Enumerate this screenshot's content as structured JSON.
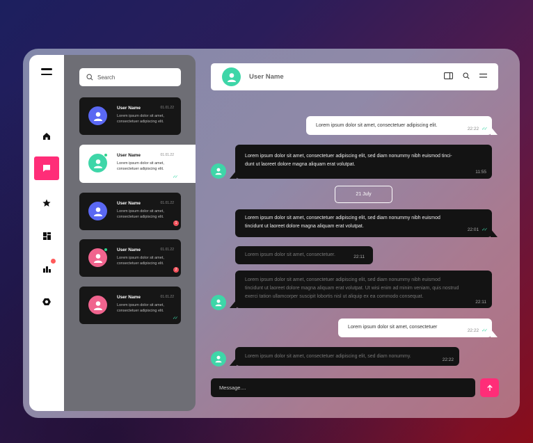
{
  "search": {
    "placeholder": "Search"
  },
  "nav": {
    "items": [
      {
        "icon": "home-icon"
      },
      {
        "icon": "chat-icon",
        "active": true
      },
      {
        "icon": "star-icon"
      },
      {
        "icon": "dashboard-icon"
      },
      {
        "icon": "chart-icon",
        "badge": true
      },
      {
        "icon": "settings-icon"
      }
    ],
    "accent": "#ff2d78"
  },
  "conversations": [
    {
      "name": "User Name",
      "time": "01.01.22",
      "preview": "Lorem ipsum dolor sit amet, consectetuer adipiscing elit.",
      "avatar_color": "#5a68f3"
    },
    {
      "name": "User Name",
      "time": "01.01.22",
      "preview": "Lorem ipsum dolor sit amet, consectetuer adipiscing elit.",
      "avatar_color": "#3ed6a8",
      "active": true
    },
    {
      "name": "User Name",
      "time": "01.01.22",
      "preview": "Lorem ipsum dolor sit amet, consectetuer adipiscing elit.",
      "avatar_color": "#5a68f3",
      "unread": "1"
    },
    {
      "name": "User Name",
      "time": "01.01.22",
      "preview": "Lorem ipsum dolor sit amet, consectetuer adipiscing elit.",
      "avatar_color": "#f0648e",
      "unread": "2"
    },
    {
      "name": "User Name",
      "time": "01.01.22",
      "preview": "Lorem ipsum dolor sit amet, consectetuer adipiscing elit.",
      "avatar_color": "#f0648e"
    }
  ],
  "chat": {
    "header_name": "User Name",
    "date_divider": "21 July",
    "messages": [
      {
        "dir": "out",
        "text": "Lorem ipsum dolor sit amet, consectetuer adipiscing elit.",
        "time": "22:22"
      },
      {
        "dir": "in",
        "line1": "Lorem ipsum dolor sit amet, consectetuer adipiscing elit, sed diam nonummy nibh euismod tinci-",
        "line2": "dunt ut laoreet dolore magna aliquam erat volutpat.",
        "time": "11:55"
      },
      {
        "dir": "in",
        "line1": "Lorem ipsum dolor sit amet, consectetuer adipiscing elit, sed diam nonummy nibh euismod",
        "line2": "tincidunt ut laoreet dolore magna aliquam erat volutpat.",
        "time": "22:01"
      },
      {
        "dir": "in",
        "text": "Lorem ipsum dolor sit amet, consectetuer.",
        "time": "22:11"
      },
      {
        "dir": "in",
        "line1": "Lorem ipsum dolor sit amet, consectetuer adipiscing elit, sed diam nonummy nibh euismod",
        "line2": "tincidunt ut laoreet dolore magna aliquam erat volutpat. Ut wisi enim ad minim veniam, quis nostrud",
        "line3": "exerci tation ullamcorper suscipit lobortis nisl ut aliquip ex ea commodo consequat.",
        "time": "22:11"
      },
      {
        "dir": "out",
        "text": "Lorem ipsum dolor sit amet, consectetuer",
        "time": "22:22"
      },
      {
        "dir": "in",
        "text": "Lorem ipsum dolor sit amet, consectetuer adipiscing elit, sed diam nonummy.",
        "time": "22:22"
      }
    ]
  },
  "composer": {
    "placeholder": "Message...."
  }
}
